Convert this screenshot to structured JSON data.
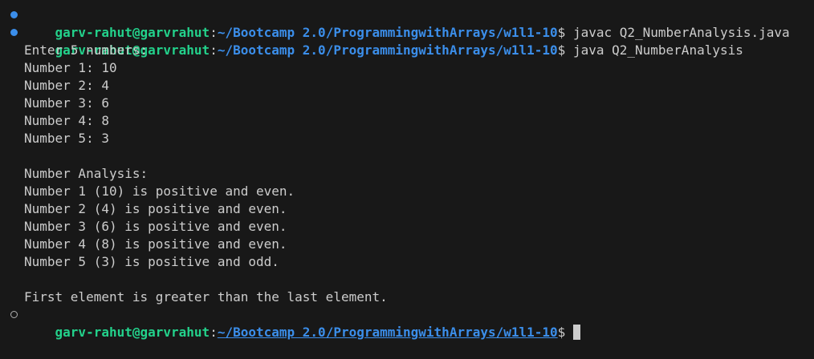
{
  "prompt": {
    "user_host": "garv-rahut@garvrahut",
    "separator": ":",
    "path": "~/Bootcamp 2.0/ProgrammingwithArrays/w1l1-10",
    "symbol": "$"
  },
  "commands": [
    " javac Q2_NumberAnalysis.java",
    " java Q2_NumberAnalysis"
  ],
  "output": [
    "Enter 5 numbers:",
    "Number 1: 10",
    "Number 2: 4",
    "Number 3: 6",
    "Number 4: 8",
    "Number 5: 3",
    "",
    "Number Analysis:",
    "Number 1 (10) is positive and even.",
    "Number 2 (4) is positive and even.",
    "Number 3 (6) is positive and even.",
    "Number 4 (8) is positive and even.",
    "Number 5 (3) is positive and odd.",
    "",
    "First element is greater than the last element."
  ],
  "colors": {
    "background": "#181818",
    "user_host": "#23d18b",
    "path": "#3b8eea",
    "text": "#cccccc"
  }
}
